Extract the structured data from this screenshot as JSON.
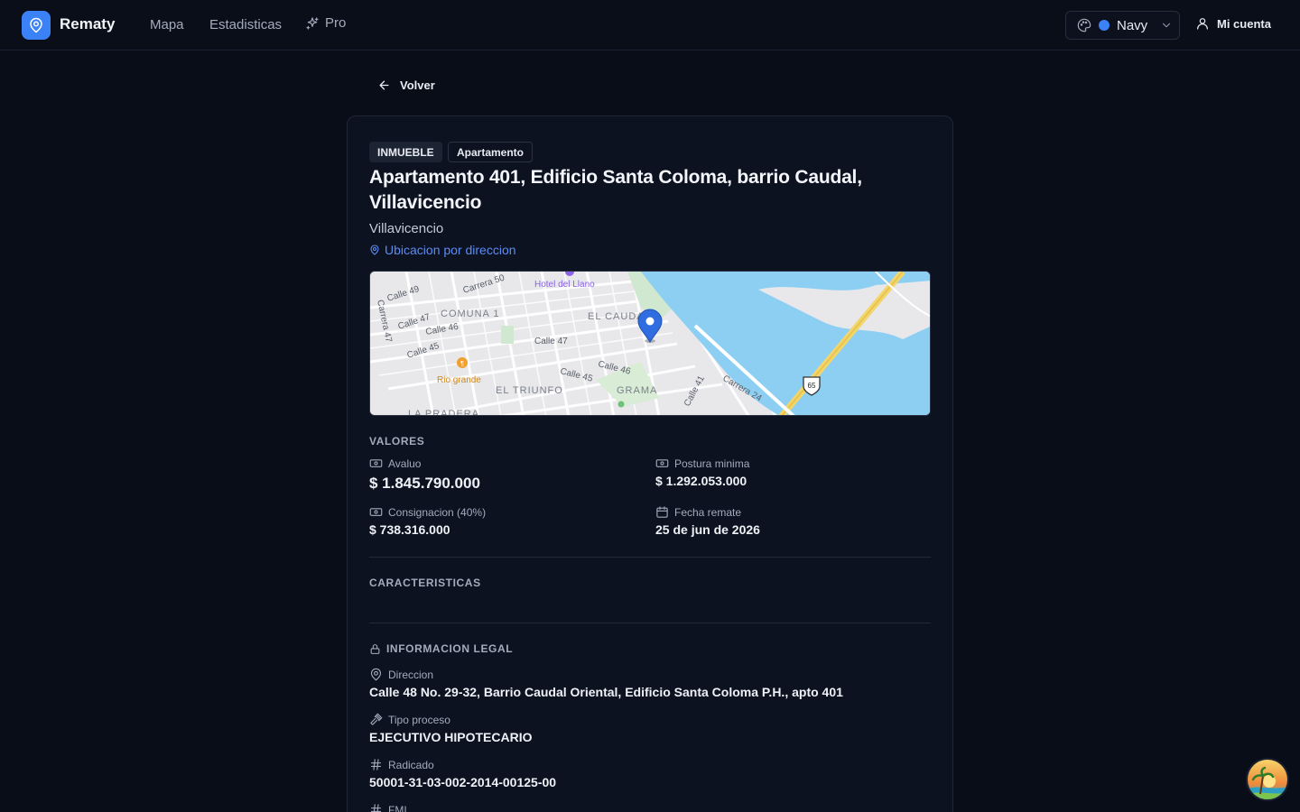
{
  "nav": {
    "brand": "Rematy",
    "links": [
      "Mapa",
      "Estadisticas"
    ],
    "pro_label": "Pro",
    "theme_label": "Navy",
    "theme_color": "#3b82f6",
    "account_label": "Mi cuenta"
  },
  "back_label": "Volver",
  "property": {
    "badges": [
      "INMUEBLE",
      "Apartamento"
    ],
    "title": "Apartamento 401, Edificio Santa Coloma, barrio Caudal, Villavicencio",
    "city": "Villavicencio",
    "location_link": "Ubicacion por direccion"
  },
  "map": {
    "labels": {
      "calle49": "Calle 49",
      "carrera50": "Carrera 50",
      "hotel": "Hotel del Llano",
      "carrera47": "Carrera 47",
      "calle47a": "Calle 47",
      "comuna": "COMUNA 1",
      "elcaudal": "EL CAUDAL",
      "calle46a": "Calle 46",
      "calle47b": "Calle 47",
      "calle45a": "Calle 45",
      "calle46b": "Calle 46",
      "rio": "Rio grande",
      "calle45b": "Calle 45",
      "triunfo": "EL TRIUNFO",
      "grama": "GRAMA",
      "calle41": "Calle 41",
      "carrera24": "Carrera 24",
      "pradera": "LA PRADERA",
      "route": "65"
    }
  },
  "values": {
    "heading": "VALORES",
    "avaluo_label": "Avaluo",
    "avaluo_value": "$ 1.845.790.000",
    "postura_label": "Postura minima",
    "postura_value": "$ 1.292.053.000",
    "consignacion_label": "Consignacion (40%)",
    "consignacion_value": "$ 738.316.000",
    "fecha_label": "Fecha remate",
    "fecha_value": "25 de jun de 2026"
  },
  "caracteristicas_heading": "CARACTERISTICAS",
  "legal": {
    "heading": "INFORMACION LEGAL",
    "direccion_label": "Direccion",
    "direccion_value": "Calle 48 No. 29-32, Barrio Caudal Oriental, Edificio Santa Coloma P.H., apto 401",
    "tipo_label": "Tipo proceso",
    "tipo_value": "EJECUTIVO HIPOTECARIO",
    "radicado_label": "Radicado",
    "radicado_value": "50001-31-03-002-2014-00125-00",
    "fmi_label": "FMI"
  }
}
